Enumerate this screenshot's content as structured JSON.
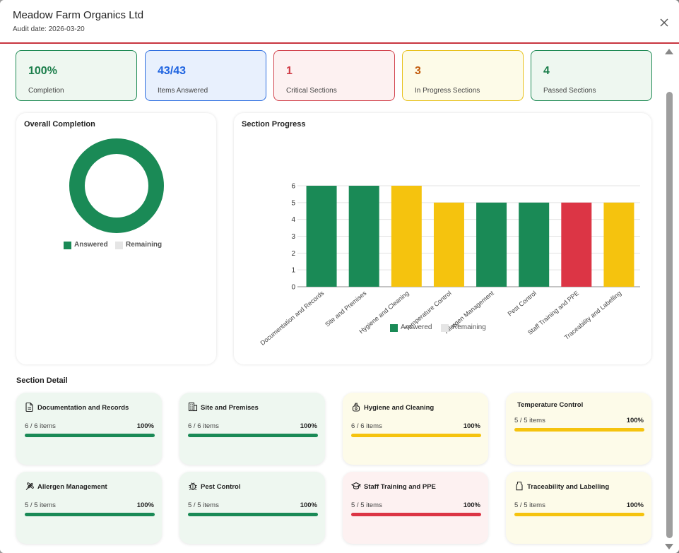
{
  "header": {
    "title": "Meadow Farm Organics Ltd",
    "subtitle": "Audit date: 2026-03-20",
    "close_icon": "close-icon"
  },
  "stats": [
    {
      "value": "100%",
      "label": "Completion",
      "tone": "green"
    },
    {
      "value": "43/43",
      "label": "Items Answered",
      "tone": "blue"
    },
    {
      "value": "1",
      "label": "Critical Sections",
      "tone": "red"
    },
    {
      "value": "3",
      "label": "In Progress Sections",
      "tone": "yellow"
    },
    {
      "value": "4",
      "label": "Passed Sections",
      "tone": "green"
    }
  ],
  "overall": {
    "title": "Overall Completion",
    "answered_fraction": 1.0,
    "legend": [
      "Answered",
      "Remaining"
    ]
  },
  "colors": {
    "green": "#1a8a56",
    "yellow": "#f5c30e",
    "red": "#dc3545",
    "remaining": "#e5e5e5",
    "header_rule": "#c8353f"
  },
  "chart_data": {
    "type": "bar",
    "title": "Section Progress",
    "categories": [
      "Documentation and Records",
      "Site and Premises",
      "Hygiene and Cleaning",
      "Temperature Control",
      "Allergen Management",
      "Pest Control",
      "Staff Training and PPE",
      "Traceability and Labelling"
    ],
    "series": [
      {
        "name": "Answered",
        "values": [
          6,
          6,
          6,
          5,
          5,
          5,
          5,
          5
        ]
      },
      {
        "name": "Remaining",
        "values": [
          0,
          0,
          0,
          0,
          0,
          0,
          0,
          0
        ]
      }
    ],
    "bar_colors": [
      "green",
      "green",
      "yellow",
      "yellow",
      "green",
      "green",
      "red",
      "yellow"
    ],
    "ylim": [
      0,
      6
    ],
    "yticks": [
      "0",
      "1",
      "2",
      "3",
      "4",
      "5",
      "6"
    ],
    "grid": true,
    "legend_position": "bottom",
    "stacked": true
  },
  "section_detail": {
    "title": "Section Detail",
    "cards": [
      {
        "name": "Documentation and Records",
        "items": "6 / 6 items",
        "pct": "100%",
        "tone": "green",
        "icon": "document-icon"
      },
      {
        "name": "Site and Premises",
        "items": "6 / 6 items",
        "pct": "100%",
        "tone": "green",
        "icon": "building-icon"
      },
      {
        "name": "Hygiene and Cleaning",
        "items": "6 / 6 items",
        "pct": "100%",
        "tone": "yellow",
        "icon": "soap-bottle-icon"
      },
      {
        "name": "Temperature Control",
        "items": "5 / 5 items",
        "pct": "100%",
        "tone": "yellow",
        "icon": ""
      },
      {
        "name": "Allergen Management",
        "items": "5 / 5 items",
        "pct": "100%",
        "tone": "green",
        "icon": "wheat-icon"
      },
      {
        "name": "Pest Control",
        "items": "5 / 5 items",
        "pct": "100%",
        "tone": "green",
        "icon": "bug-icon"
      },
      {
        "name": "Staff Training and PPE",
        "items": "5 / 5 items",
        "pct": "100%",
        "tone": "red",
        "icon": "graduation-cap-icon"
      },
      {
        "name": "Traceability and Labelling",
        "items": "5 / 5 items",
        "pct": "100%",
        "tone": "yellow",
        "icon": "tag-icon"
      }
    ]
  }
}
